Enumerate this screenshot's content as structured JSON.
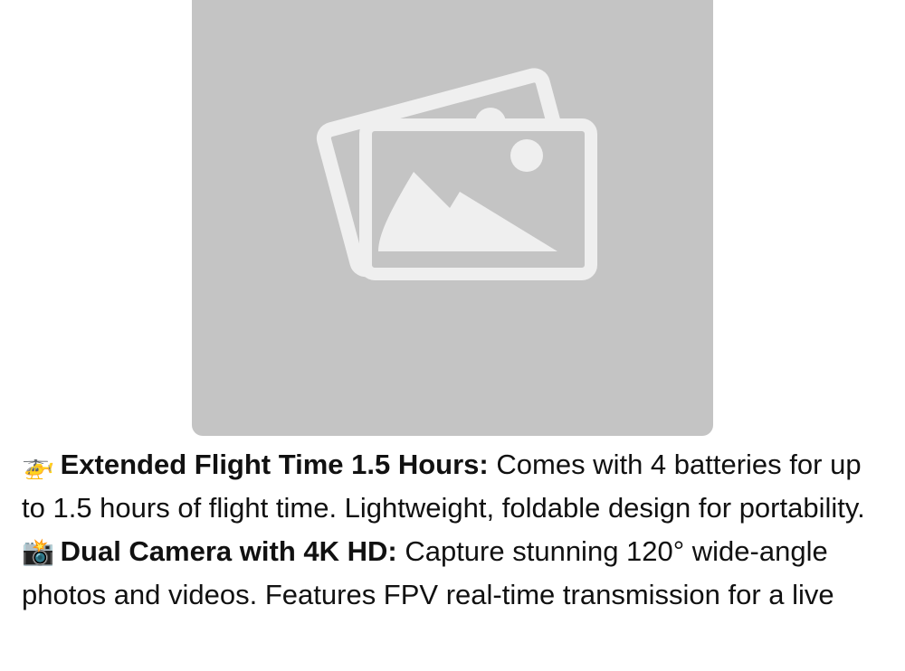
{
  "product_image": {
    "icon": "image-placeholder-icon"
  },
  "features": [
    {
      "emoji": "🚁",
      "title": "Extended Flight Time 1.5 Hours:",
      "text": "Comes with 4 batteries for up to 1.5 hours of flight time. Lightweight, foldable design for portability."
    },
    {
      "emoji": "📸",
      "title": "Dual Camera with 4K HD:",
      "text": "Capture stunning 120° wide-angle photos and videos. Features FPV real-time transmission for a live"
    }
  ]
}
